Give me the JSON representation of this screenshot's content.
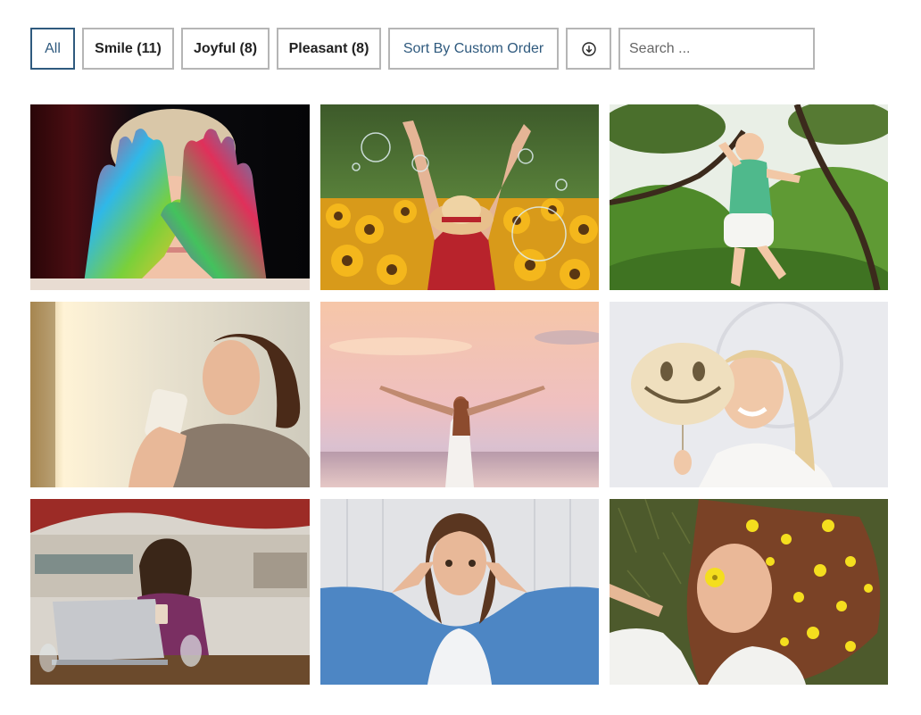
{
  "filters": [
    {
      "label": "All",
      "active": true
    },
    {
      "label": "Smile (11)",
      "active": false
    },
    {
      "label": "Joyful (8)",
      "active": false
    },
    {
      "label": "Pleasant (8)",
      "active": false
    }
  ],
  "sort": {
    "label": "Sort By Custom Order",
    "direction_icon": "arrow-down-circle-icon"
  },
  "search": {
    "placeholder": "Search ...",
    "value": ""
  },
  "colors": {
    "accent": "#2f5a7e",
    "border": "#b5b5b5"
  },
  "gallery": {
    "items": [
      {
        "name": "painted-hands-photo"
      },
      {
        "name": "sunflower-field-photo"
      },
      {
        "name": "baby-jumping-photo"
      },
      {
        "name": "woman-coffee-photo"
      },
      {
        "name": "sunset-beach-photo"
      },
      {
        "name": "smiley-balloon-photo"
      },
      {
        "name": "woman-laptop-cafe-photo"
      },
      {
        "name": "peace-sign-photo"
      },
      {
        "name": "flowers-hair-photo"
      }
    ]
  }
}
